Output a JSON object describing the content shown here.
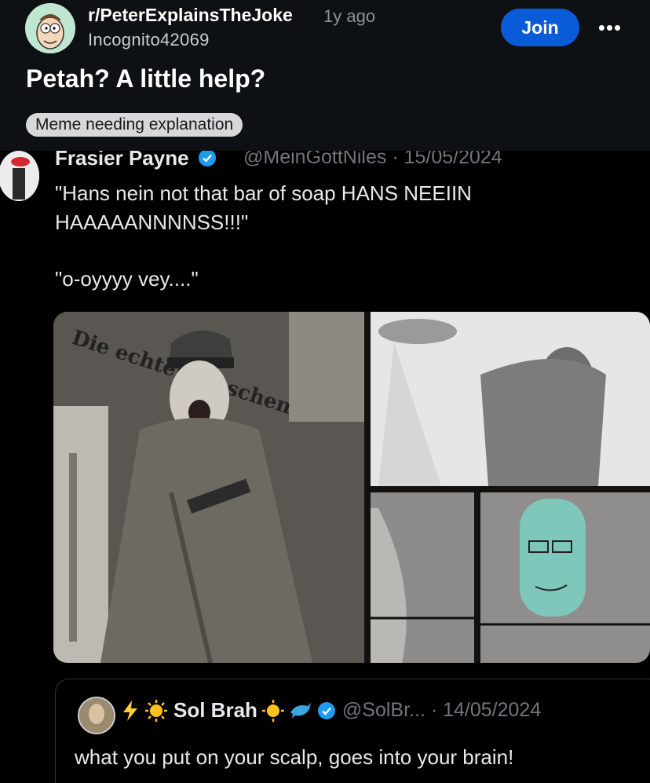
{
  "post": {
    "subreddit": "r/PeterExplainsTheJoke",
    "age": "1y ago",
    "author": "Incognito42069",
    "join_label": "Join",
    "more_label": "•••",
    "title": "Petah? A little help?",
    "flair": "Meme needing explanation"
  },
  "tweet": {
    "name": "Frasier Payne",
    "handle_date": "@MeinGottNiles · 15/05/2024",
    "text_line1": "\"Hans nein not that bar of soap HANS NEEIIN HAAAAANNNNSS!!!\"",
    "text_line2": "\"o-oyyyy vey....\"",
    "image_sign_text": "Die echten Duschen"
  },
  "quoted_tweet": {
    "name": "Sol Brah",
    "handle_date": "@SolBr... · 14/05/2024",
    "text": "what you put on your scalp, goes into your brain!"
  },
  "colors": {
    "header_bg": "#0e1113",
    "join_button": "#0a5bd8",
    "verified_blue": "#1d9bf0",
    "muted_text": "#71767b"
  }
}
